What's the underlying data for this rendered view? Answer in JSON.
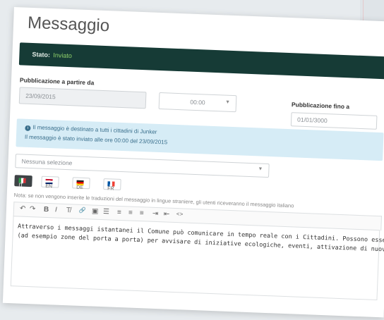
{
  "page": {
    "title": "Messaggio",
    "status_label": "Stato:",
    "status_value": "Inviato"
  },
  "form": {
    "pub_from_label": "Pubblicazione a partire da",
    "pub_from_date": "23/09/2015",
    "pub_from_time": "00:00",
    "pub_to_label": "Pubblicazione fino a",
    "pub_to_date": "01/01/3000"
  },
  "info": {
    "line1": "Il messaggio è destinato a tutti i cittadini di Junker",
    "line2": "Il messaggio è stato inviato alle ore 00:00 del 23/09/2015"
  },
  "select": {
    "placeholder": "Nessuna selezione"
  },
  "languages": [
    {
      "code": "IT",
      "active": true
    },
    {
      "code": "EN",
      "active": false
    },
    {
      "code": "DE",
      "active": false
    },
    {
      "code": "FR",
      "active": false
    }
  ],
  "note": "Nota: se non vengono inserite le traduzioni del messaggio in lingue straniere, gli utenti riceveranno il messaggio italiano",
  "editor": {
    "line1": "Attraverso i messaggi istantanei il Comune può comunicare in tempo reale con i Cittadini. Possono essere inviate",
    "line2": "(ad esempio zone del porta a porta) per avvisare di iniziative ecologiche, eventi, attivazione di nuovi punti di racco"
  },
  "toolbar": {
    "undo": "↶",
    "redo": "↷",
    "bold": "B",
    "italic": "I",
    "clear": "T̸",
    "link": "🔗",
    "image": "▣",
    "list": "☰",
    "align_left": "≡",
    "align_center": "≡",
    "align_right": "≡",
    "indent": "⇥",
    "outdent": "⇤",
    "code": "<>"
  }
}
